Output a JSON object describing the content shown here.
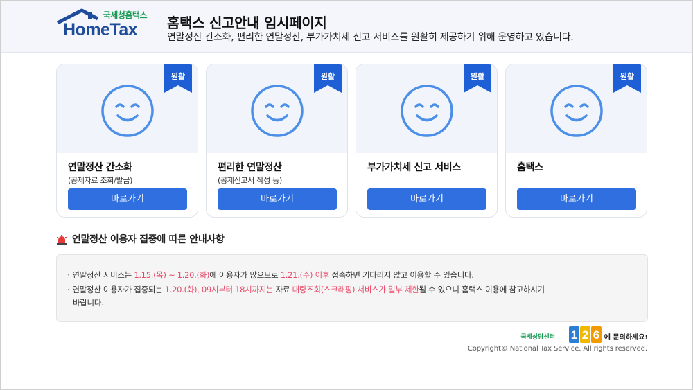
{
  "header": {
    "logo_top": "국세청홈택스",
    "logo_main": "HomeTax",
    "title": "홈택스 신고안내 임시페이지",
    "subtitle": "연말정산 간소화, 편리한 연말정산, 부가가치세 신고 서비스를 원활히 제공하기 위해 운영하고 있습니다."
  },
  "cards": [
    {
      "badge": "원활",
      "title": "연말정산 간소화",
      "sub": "(공제자료 조회/발급)",
      "button": "바로가기"
    },
    {
      "badge": "원활",
      "title": "편리한 연말정산",
      "sub": "(공제신고서 작성 등)",
      "button": "바로가기"
    },
    {
      "badge": "원활",
      "title": "부가가치세 신고 서비스",
      "sub": "",
      "button": "바로가기"
    },
    {
      "badge": "원활",
      "title": "홈택스",
      "sub": "",
      "button": "바로가기"
    }
  ],
  "notice": {
    "title": "연말정산 이용자 집중에 따른 안내사항",
    "line1": {
      "a": "연말정산 서비스는 ",
      "b": "1.15.(목) ~ 1.20.(화)",
      "c": "에 이용자가 많으므로 ",
      "d": "1.21.(수) 이후",
      "e": " 접속하면 기다리지 않고 이용할 수 있습니다."
    },
    "line2": {
      "a": "연말정산 이용자가 집중되는 ",
      "b": "1.20.(화), 09시부터 18시까지는",
      "c": " 자료 ",
      "d": "대량조회(스크래핑) 서비스가 일부 제한",
      "e": "될 수 있으니 홈택스 이용에 참고하시기"
    },
    "line3": "바랍니다.",
    "bullet": "·"
  },
  "footer": {
    "call_small": "국세상담센터",
    "call_number": "126",
    "call_tail": "에 문의하세요!",
    "copyright": "Copyright© National Tax Service. All rights reserved."
  },
  "colors": {
    "accent_blue": "#2f6fe0",
    "badge_blue": "#1f5fd6",
    "highlight_red": "#e84b6a",
    "logo_green": "#1a9a55"
  },
  "icons": {
    "card_icon": "smiley-face-icon",
    "badge_icon": "ribbon-bookmark-icon",
    "notice_icon": "siren-icon"
  }
}
